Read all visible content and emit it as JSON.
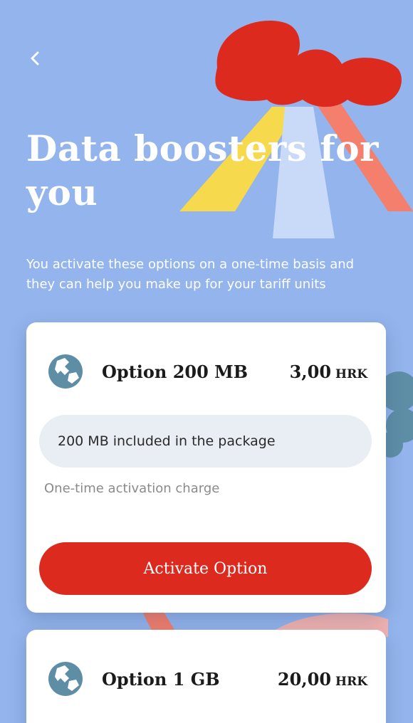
{
  "header": {
    "back_icon": "chevron-left-icon",
    "title": "Data boosters for you",
    "subtitle": "You activate these options on a one-time basis and they can help  you make up for your tariff units"
  },
  "options": [
    {
      "name": "Option 200 MB",
      "price": "3,00",
      "currency": "HRK",
      "icon": "globe-icon",
      "included": "200 MB included in the package",
      "note": "One-time activation charge",
      "button_label": "Activate Option"
    },
    {
      "name": "Option 1 GB",
      "price": "20,00",
      "currency": "HRK",
      "icon": "globe-icon"
    }
  ],
  "colors": {
    "background": "#93b4ec",
    "accent_red": "#dc2a1f",
    "icon_blue": "#5e8ea6",
    "yellow": "#f6d94c",
    "salmon": "#f37f6c"
  }
}
